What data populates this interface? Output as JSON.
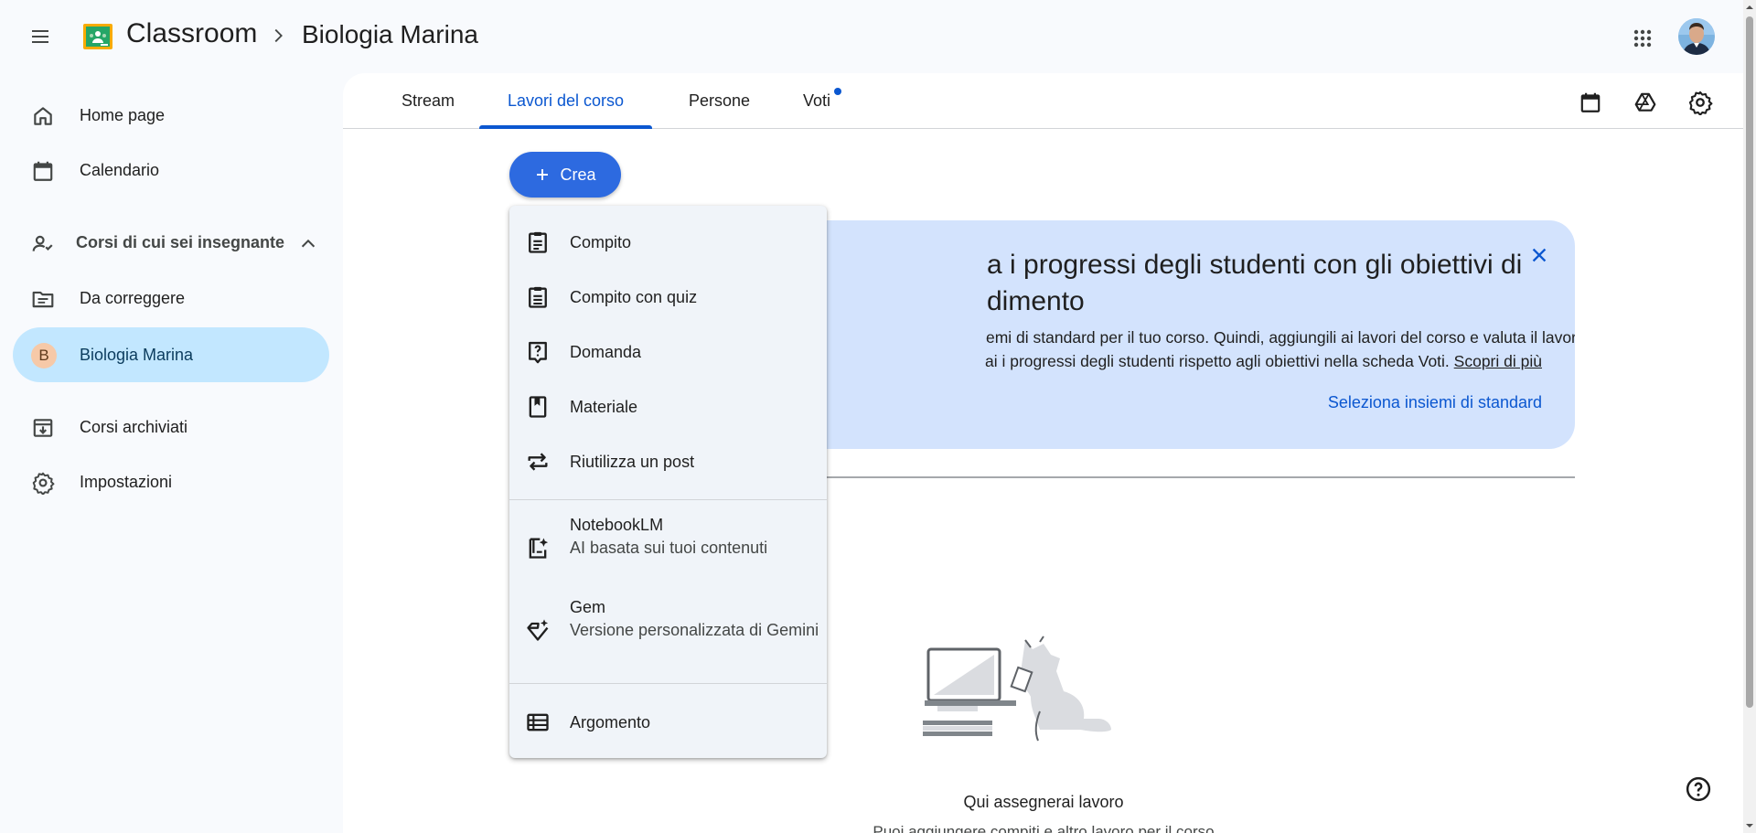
{
  "header": {
    "menu_icon": "hamburger-menu-icon",
    "app_title": "Classroom",
    "course_title": "Biologia Marina",
    "apps_icon": "google-apps-grid-icon",
    "avatar": "user-avatar"
  },
  "sidebar": {
    "items": [
      {
        "label": "Home page",
        "icon": "home-icon"
      },
      {
        "label": "Calendario",
        "icon": "calendar-icon"
      }
    ],
    "teaching_section": {
      "label": "Corsi di cui sei insegnante",
      "icon": "people-icon",
      "toggle_icon": "chevron-up-icon"
    },
    "teaching_items": [
      {
        "label": "Da correggere",
        "icon": "folder-list-icon"
      },
      {
        "label": "Biologia Marina",
        "initial": "B",
        "active": true
      }
    ],
    "bottom_items": [
      {
        "label": "Corsi archiviati",
        "icon": "archive-icon"
      },
      {
        "label": "Impostazioni",
        "icon": "gear-icon"
      }
    ]
  },
  "tabs": [
    {
      "label": "Stream",
      "active": false
    },
    {
      "label": "Lavori del corso",
      "active": true
    },
    {
      "label": "Persone",
      "active": false
    },
    {
      "label": "Voti",
      "active": false,
      "dot": true
    }
  ],
  "toolbar_icons": [
    "calendar-icon",
    "drive-icon",
    "gear-icon"
  ],
  "create_button": {
    "label": "Crea",
    "icon": "plus-icon"
  },
  "banner": {
    "title_line1": "a i progressi degli studenti con gli obiettivi di",
    "title_line2": "dimento",
    "text_line1": "emi di standard per il tuo corso. Quindi, aggiungili ai lavori del corso e valuta il lavoro degli",
    "text_line2": "ai i progressi degli studenti rispetto agli obiettivi nella scheda Voti.",
    "link": "Scopri di più",
    "action": "Seleziona insiemi di standard",
    "close_icon": "close-icon"
  },
  "create_menu": {
    "items": [
      {
        "label": "Compito",
        "icon": "assignment-icon"
      },
      {
        "label": "Compito con quiz",
        "icon": "quiz-assignment-icon"
      },
      {
        "label": "Domanda",
        "icon": "question-icon"
      },
      {
        "label": "Materiale",
        "icon": "material-icon"
      },
      {
        "label": "Riutilizza un post",
        "icon": "repeat-icon"
      }
    ],
    "ai_items": [
      {
        "label": "NotebookLM",
        "sub": "AI basata sui tuoi contenuti",
        "icon": "notebooklm-icon"
      },
      {
        "label": "Gem",
        "sub": "Versione personalizzata di Gemini",
        "icon": "gem-icon"
      }
    ],
    "topic_item": {
      "label": "Argomento",
      "icon": "topic-list-icon"
    }
  },
  "empty_state": {
    "title": "Qui assegnerai lavoro",
    "subtitle": "Puoi aggiungere compiti e altro lavoro per il corso"
  },
  "help_icon": "help-icon",
  "colors": {
    "accent": "#0b57d0",
    "create_button": "#2d6ae0",
    "active_nav": "#c2e7ff",
    "banner": "#d3e3fd"
  }
}
